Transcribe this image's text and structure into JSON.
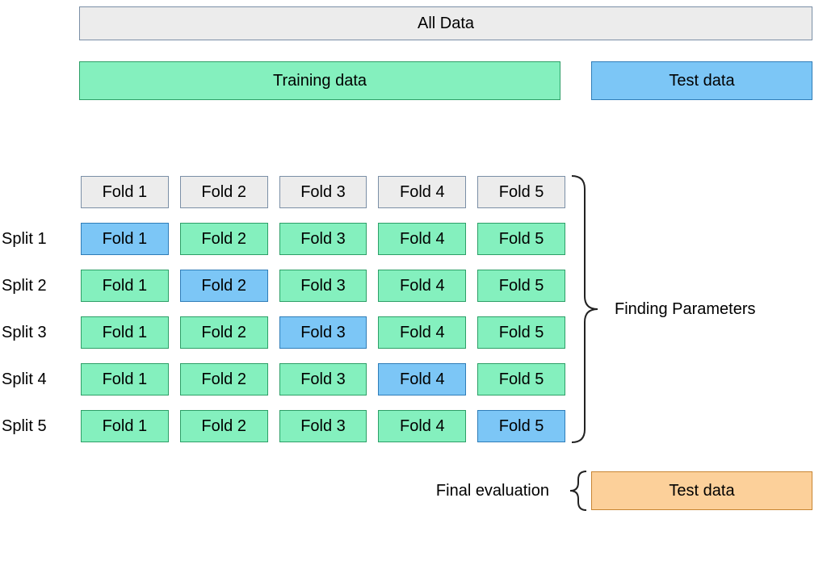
{
  "colors": {
    "grey_fill": "#ECECEC",
    "grey_border": "#7B8FA6",
    "green_fill": "#84F0BE",
    "green_border": "#2D9F67",
    "blue_fill": "#7CC6F6",
    "blue_border": "#2F7DB8",
    "orange_fill": "#FCD09A",
    "orange_border": "#C88532",
    "brace": "#222"
  },
  "header": {
    "all_data": "All Data",
    "training": "Training data",
    "test": "Test data"
  },
  "fold_labels": [
    "Fold 1",
    "Fold 2",
    "Fold 3",
    "Fold 4",
    "Fold 5"
  ],
  "splits": [
    {
      "label": "Split 1",
      "test_index": 0
    },
    {
      "label": "Split 2",
      "test_index": 1
    },
    {
      "label": "Split 3",
      "test_index": 2
    },
    {
      "label": "Split 4",
      "test_index": 3
    },
    {
      "label": "Split 5",
      "test_index": 4
    }
  ],
  "right": {
    "finding": "Finding Parameters",
    "final_eval": "Final evaluation",
    "test": "Test data"
  }
}
